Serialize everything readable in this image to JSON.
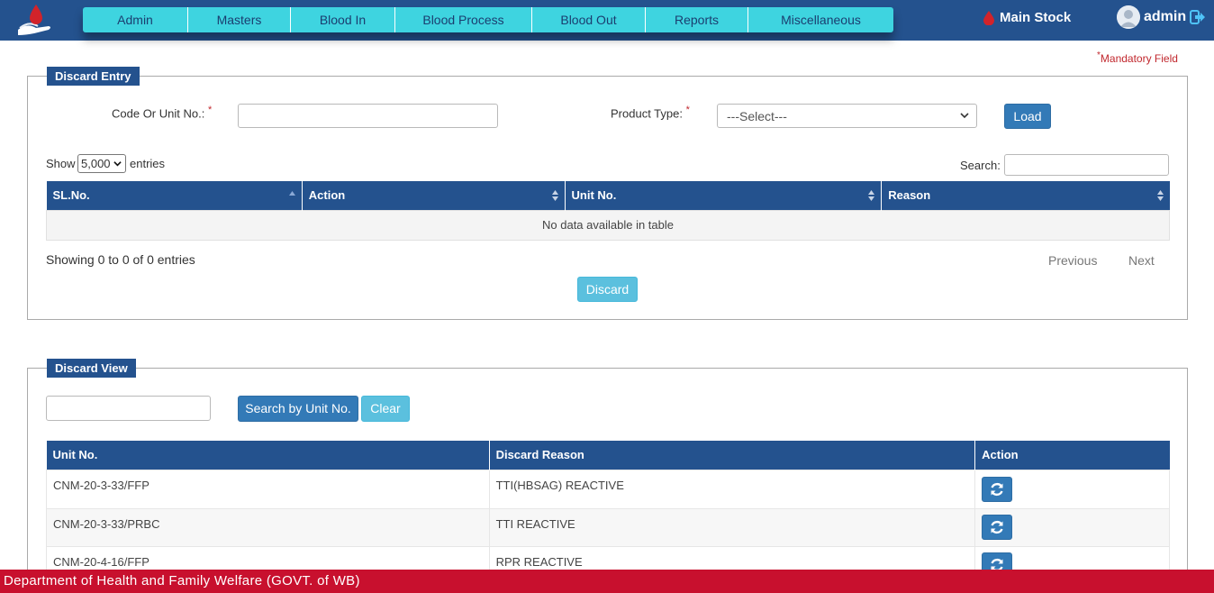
{
  "nav": {
    "items": [
      {
        "label": "Admin"
      },
      {
        "label": "Masters"
      },
      {
        "label": "Blood In"
      },
      {
        "label": "Blood Process"
      },
      {
        "label": "Blood Out"
      },
      {
        "label": "Reports"
      },
      {
        "label": "Miscellaneous"
      }
    ]
  },
  "header": {
    "main_stock": "Main Stock",
    "user": "admin"
  },
  "mandatory_note": "Mandatory Field",
  "discard_entry": {
    "legend": "Discard Entry",
    "code_label": "Code Or Unit No.:",
    "code_value": "",
    "product_type_label": "Product Type:",
    "product_type_selected": "---Select---",
    "load_button": "Load",
    "show_label": "Show",
    "show_value": "5,000",
    "entries_label": "entries",
    "search_label": "Search:",
    "columns": [
      "SL.No.",
      "Action",
      "Unit No.",
      "Reason"
    ],
    "empty_message": "No data available in table",
    "showing_text": "Showing 0 to 0 of 0 entries",
    "previous": "Previous",
    "next": "Next",
    "discard_button": "Discard"
  },
  "discard_view": {
    "legend": "Discard View",
    "search_value": "",
    "search_button": "Search by Unit No.",
    "clear_button": "Clear",
    "columns": [
      "Unit No.",
      "Discard Reason",
      "Action"
    ],
    "rows": [
      {
        "unit": "CNM-20-3-33/FFP",
        "reason": "TTI(HBSAG) REACTIVE"
      },
      {
        "unit": "CNM-20-3-33/PRBC",
        "reason": "TTI REACTIVE"
      },
      {
        "unit": "CNM-20-4-16/FFP",
        "reason": "RPR REACTIVE"
      }
    ]
  },
  "footer": "Department of Health and Family Welfare (GOVT. of WB)",
  "colors": {
    "header_blue": "#24528e",
    "nav_cyan": "#3ed4e0",
    "footer_red": "#c8102e",
    "required_red": "#c1272d"
  }
}
